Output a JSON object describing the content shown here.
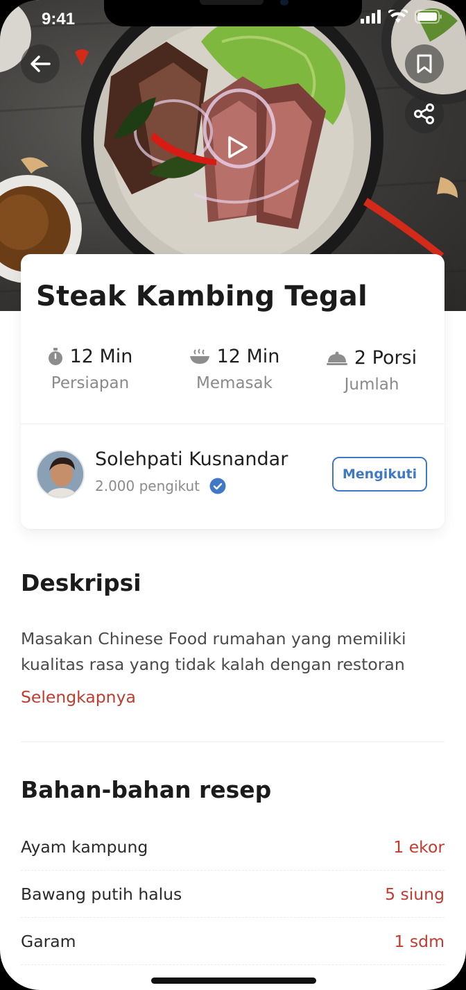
{
  "status_bar": {
    "time": "9:41"
  },
  "hero": {
    "icons": {
      "back": "arrow-left-icon",
      "bookmark": "bookmark-icon",
      "share": "share-icon",
      "play": "play-icon"
    }
  },
  "recipe": {
    "title": "Steak Kambing Tegal",
    "stats": [
      {
        "icon": "timer-icon",
        "value": "12 Min",
        "label": "Persiapan"
      },
      {
        "icon": "bowl-icon",
        "value": "12 Min",
        "label": "Memasak"
      },
      {
        "icon": "cloche-icon",
        "value": "2 Porsi",
        "label": "Jumlah"
      }
    ]
  },
  "author": {
    "name": "Solehpati Kusnandar",
    "followers": "2.000 pengikut",
    "follow_label": "Mengikuti"
  },
  "description": {
    "title": "Deskripsi",
    "text": "Masakan Chinese Food rumahan yang memiliki kualitas rasa yang tidak kalah dengan restoran",
    "more": "Selengkapnya"
  },
  "ingredients": {
    "title": "Bahan-bahan resep",
    "items": [
      {
        "name": "Ayam kampung",
        "qty": "1 ekor"
      },
      {
        "name": "Bawang putih halus",
        "qty": "5 siung"
      },
      {
        "name": "Garam",
        "qty": "1 sdm"
      }
    ]
  },
  "colors": {
    "accent_red": "#c23b2f",
    "accent_blue": "#3f78c5",
    "verified": "#3f78c5"
  }
}
